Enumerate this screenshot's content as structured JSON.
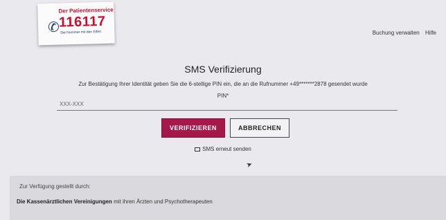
{
  "logo": {
    "line1": "Der Patientenservice",
    "number": "116117",
    "line3": "Die Nummer mit den Elfen"
  },
  "nav": {
    "manage_booking": "Buchung verwalten",
    "help": "Hilfe"
  },
  "page_title": "SMS Verifizierung",
  "description": "Zur Bestätigung Ihrer Identität geben Sie die 6-stellige PIN ein, die an die Rufnummer +49*******2878 gesendet wurde",
  "pin": {
    "label": "PIN*",
    "placeholder": "XXX-XXX"
  },
  "buttons": {
    "verify": "VERIFIZIEREN",
    "cancel": "ABBRECHEN"
  },
  "resend_label": "SMS erneut senden",
  "footer": {
    "provided_by": "Zur Verfügung gestellt durch:",
    "org_bold": "Die Kassenärztlichen Vereinigungen",
    "org_rest": "mit ihren Ärzten und Psychotherapeuten"
  },
  "colors": {
    "primary": "#a4194a",
    "brand_red": "#c8102e"
  }
}
